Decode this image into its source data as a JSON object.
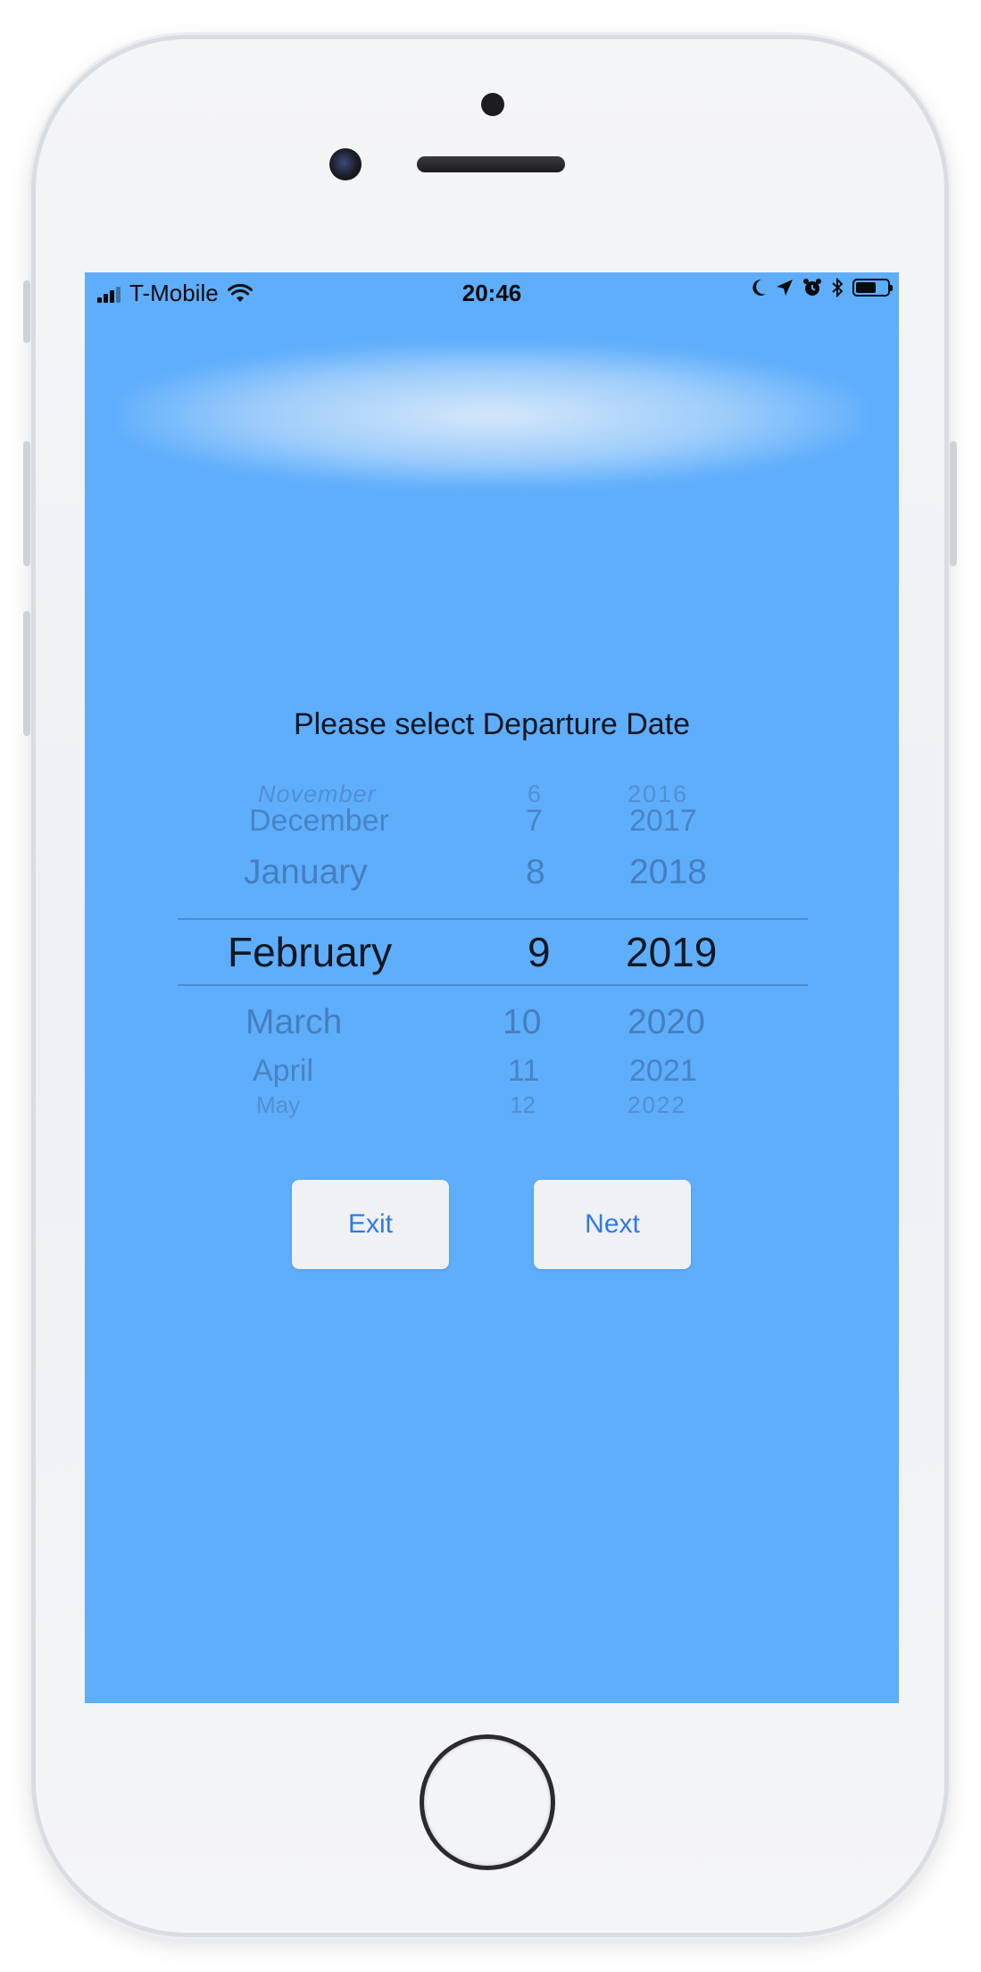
{
  "status_bar": {
    "carrier": "T-Mobile",
    "time": "20:46",
    "icons": [
      "signal-icon",
      "wifi-icon",
      "moon-icon",
      "location-arrow-icon",
      "alarm-icon",
      "bluetooth-icon",
      "battery-icon"
    ]
  },
  "prompt": "Please select Departure Date",
  "picker": {
    "months": [
      "November",
      "December",
      "January",
      "February",
      "March",
      "April",
      "May"
    ],
    "days": [
      "6",
      "7",
      "8",
      "9",
      "10",
      "11",
      "12"
    ],
    "years": [
      "2016",
      "2017",
      "2018",
      "2019",
      "2020",
      "2021",
      "2022"
    ],
    "selected": {
      "month": "February",
      "day": "9",
      "year": "2019"
    }
  },
  "buttons": {
    "exit": "Exit",
    "next": "Next"
  },
  "colors": {
    "screen_bg": "#5eaefc",
    "button_text": "#2f7ae6",
    "button_bg": "#eff1f4"
  }
}
